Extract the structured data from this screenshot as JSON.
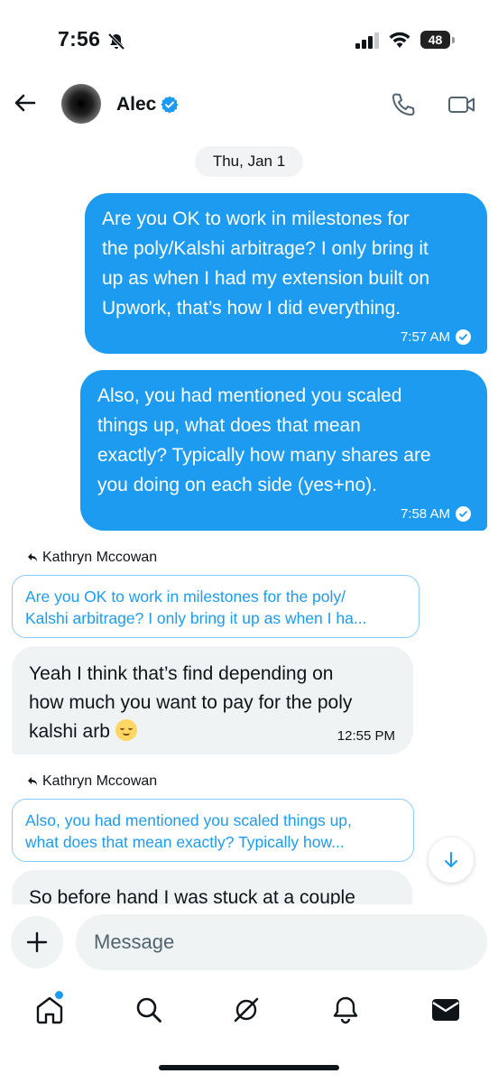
{
  "status_bar": {
    "time": "7:56",
    "battery": "48"
  },
  "header": {
    "contact_name": "Alec"
  },
  "date_chip": "Thu, Jan 1",
  "messages_out": [
    {
      "lines": [
        "Are you OK to work in milestones for",
        "the poly/Kalshi arbitrage? I only bring it",
        "up as when I had my extension built on",
        "Upwork, that’s how I did everything."
      ],
      "time": "7:57 AM"
    },
    {
      "lines": [
        "Also, you had mentioned you scaled",
        "things up, what does that mean",
        "exactly? Typically how many shares are",
        "you doing on each side (yes+no)."
      ],
      "time": "7:58 AM"
    }
  ],
  "messages_in": [
    {
      "reply_to_name": "Kathryn Mccowan",
      "quote_lines": [
        "Are you OK to work in milestones for the poly/",
        "Kalshi arbitrage? I only bring it up as when I ha..."
      ],
      "lines": [
        "Yeah I think that’s find depending on",
        "how much you want to pay for the poly",
        "kalshi arb"
      ],
      "time": "12:55 PM"
    },
    {
      "reply_to_name": "Kathryn Mccowan",
      "quote_lines": [
        "Also, you had mentioned you scaled things up,",
        "what does that mean exactly? Typically how..."
      ],
      "lines": [
        "So before hand I was stuck at a couple"
      ]
    }
  ],
  "composer": {
    "placeholder": "Message"
  },
  "nav": [
    "home-icon",
    "search-icon",
    "grok-icon",
    "notifications-icon",
    "messages-icon"
  ],
  "colors": {
    "accent": "#1d9bf0",
    "incoming_bg": "#eff3f4"
  }
}
